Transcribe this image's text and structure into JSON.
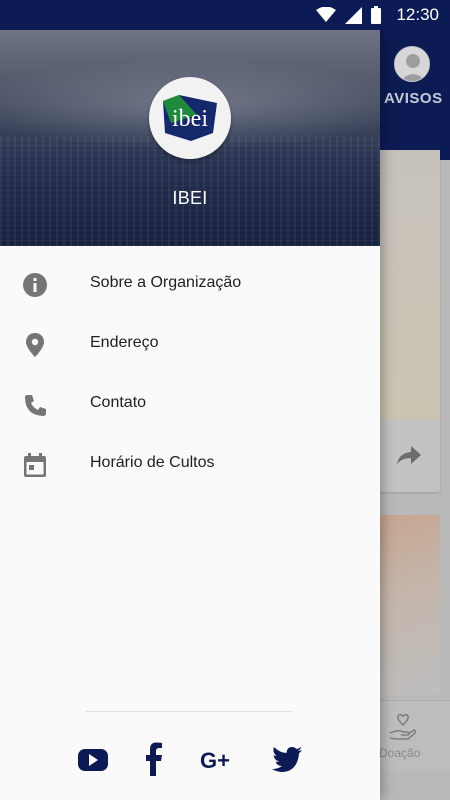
{
  "status_bar": {
    "time": "12:30",
    "icons": [
      "wifi-icon",
      "signal-icon",
      "battery-icon"
    ],
    "color": "#0d1b55"
  },
  "background_app": {
    "tab_label": "AVISOS",
    "bottom_nav_label": "Doação",
    "icons": [
      "avatar-icon",
      "share-icon",
      "donation-icon"
    ]
  },
  "drawer": {
    "organization_name": "IBEI",
    "logo_text": "ibei",
    "menu_items": [
      {
        "label": "Sobre a Organização",
        "icon": "info-icon"
      },
      {
        "label": "Endereço",
        "icon": "location-pin-icon"
      },
      {
        "label": "Contato",
        "icon": "phone-icon"
      },
      {
        "label": "Horário de Cultos",
        "icon": "calendar-icon"
      }
    ],
    "social_links": [
      {
        "name": "YouTube",
        "icon": "youtube-icon"
      },
      {
        "name": "Facebook",
        "icon": "facebook-icon"
      },
      {
        "name": "Google+",
        "icon": "google-plus-icon"
      },
      {
        "name": "Twitter",
        "icon": "twitter-icon"
      }
    ]
  },
  "colors": {
    "brand_navy": "#0d1b55",
    "logo_green": "#1f8a3b",
    "icon_gray": "#757575",
    "text_dark": "#212121"
  }
}
